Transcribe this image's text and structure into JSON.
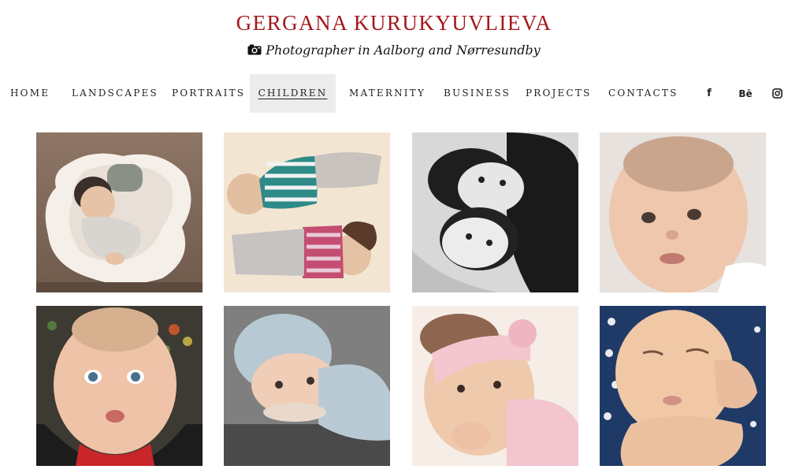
{
  "header": {
    "title": "GERGANA KURUKYUVLIEVA",
    "tagline": "Photographer in Aalborg and Nørresundby",
    "tagline_icon": "camera-icon"
  },
  "nav": {
    "items": [
      {
        "label": "HOME"
      },
      {
        "label": "LANDSCAPES"
      },
      {
        "label": "PORTRAITS"
      },
      {
        "label": "CHILDREN",
        "active": true
      },
      {
        "label": "MATERNITY"
      },
      {
        "label": "BUSINESS"
      },
      {
        "label": "PROJECTS"
      },
      {
        "label": "CONTACTS"
      }
    ],
    "social": [
      {
        "icon": "facebook-icon",
        "glyph": "f"
      },
      {
        "icon": "behance-icon",
        "glyph": "Bē"
      },
      {
        "icon": "instagram-icon",
        "glyph": "instagram"
      }
    ]
  },
  "colors": {
    "title": "#a3171b",
    "active_nav_bg": "#ececec"
  },
  "gallery": {
    "photos": [
      {
        "subject": "baby on white sheepskin rug"
      },
      {
        "subject": "two babies lying on fur rug in striped clothes"
      },
      {
        "subject": "black and white photo of two girls"
      },
      {
        "subject": "close-up baby face"
      },
      {
        "subject": "baby with blue eyes and bokeh lights"
      },
      {
        "subject": "baby in light blue knitted hat"
      },
      {
        "subject": "baby with pink headband"
      },
      {
        "subject": "sleeping newborn"
      }
    ]
  }
}
